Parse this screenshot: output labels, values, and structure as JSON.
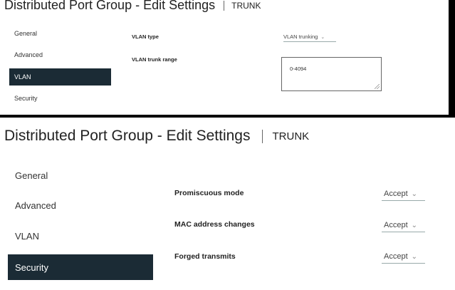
{
  "vlan_panel": {
    "title": "Distributed Port Group - Edit Settings",
    "subtitle": "TRUNK",
    "nav": [
      {
        "label": "General",
        "active": false
      },
      {
        "label": "Advanced",
        "active": false
      },
      {
        "label": "VLAN",
        "active": true
      },
      {
        "label": "Security",
        "active": false
      }
    ],
    "vlan_type": {
      "label": "VLAN type",
      "value": "VLAN trunking"
    },
    "vlan_trunk_range": {
      "label": "VLAN trunk range",
      "value": "0-4094"
    }
  },
  "security_panel": {
    "title": "Distributed Port Group - Edit Settings",
    "subtitle": "TRUNK",
    "nav": [
      {
        "label": "General",
        "active": false
      },
      {
        "label": "Advanced",
        "active": false
      },
      {
        "label": "VLAN",
        "active": false
      },
      {
        "label": "Security",
        "active": true
      }
    ],
    "settings": [
      {
        "label": "Promiscuous mode",
        "value": "Accept"
      },
      {
        "label": "MAC address changes",
        "value": "Accept"
      },
      {
        "label": "Forged transmits",
        "value": "Accept"
      }
    ]
  },
  "icons": {
    "dropdown": "chevron-down-icon",
    "resize": "resize-grip-icon"
  },
  "colors": {
    "nav_active_bg": "#1b2b35",
    "nav_active_text": "#ffffff",
    "background": "#ffffff",
    "divider": "#000000"
  }
}
